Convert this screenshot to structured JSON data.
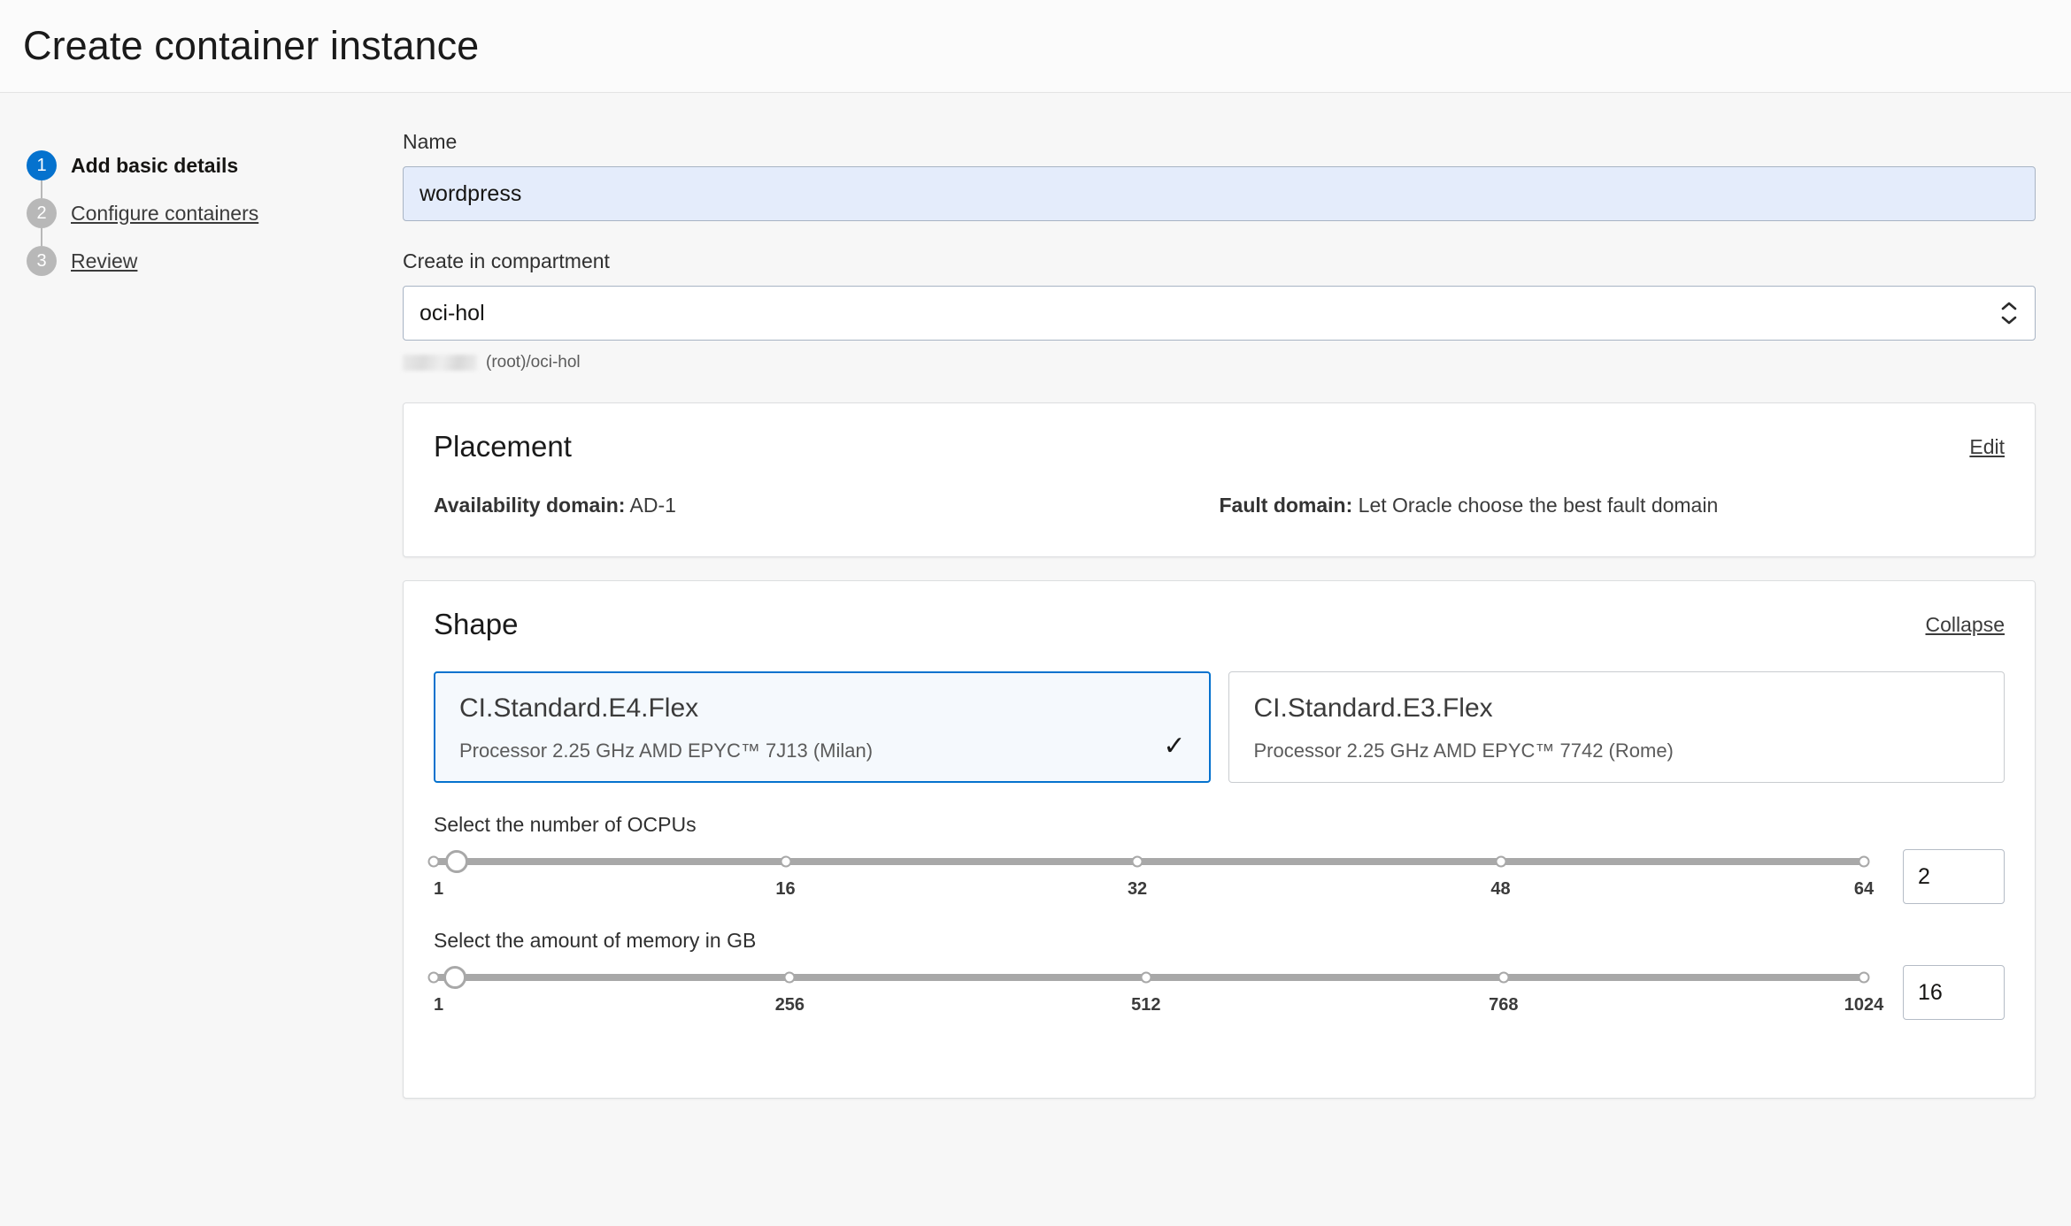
{
  "header": {
    "title": "Create container instance"
  },
  "stepper": {
    "steps": [
      {
        "num": "1",
        "label": "Add basic details",
        "state": "active"
      },
      {
        "num": "2",
        "label": "Configure containers",
        "state": "link"
      },
      {
        "num": "3",
        "label": "Review",
        "state": "link"
      }
    ]
  },
  "form": {
    "name_label": "Name",
    "name_value": "wordpress",
    "name_placeholder": "",
    "compartment_label": "Create in compartment",
    "compartment_value": "oci-hol",
    "compartment_path": "(root)/oci-hol"
  },
  "placement": {
    "title": "Placement",
    "action": "Edit",
    "availability_domain_label": "Availability domain:",
    "availability_domain_value": "AD-1",
    "fault_domain_label": "Fault domain:",
    "fault_domain_value": "Let Oracle choose the best fault domain"
  },
  "shape": {
    "title": "Shape",
    "action": "Collapse",
    "cards": [
      {
        "name": "CI.Standard.E4.Flex",
        "desc": "Processor 2.25 GHz AMD EPYC™ 7J13 (Milan)",
        "selected": true,
        "check": "✓"
      },
      {
        "name": "CI.Standard.E3.Flex",
        "desc": "Processor 2.25 GHz AMD EPYC™ 7742 (Rome)",
        "selected": false,
        "check": ""
      }
    ],
    "ocpu": {
      "label": "Select the number of OCPUs",
      "value": "2",
      "min": 1,
      "max": 64,
      "ticks": [
        "1",
        "16",
        "32",
        "48",
        "64"
      ],
      "tick_positions": [
        0,
        24.6,
        49.2,
        74.6,
        100
      ]
    },
    "memory": {
      "label": "Select the amount of memory in GB",
      "value": "16",
      "min": 1,
      "max": 1024,
      "ticks": [
        "1",
        "256",
        "512",
        "768",
        "1024"
      ],
      "tick_positions": [
        0,
        24.9,
        49.8,
        74.8,
        100
      ]
    }
  },
  "colors": {
    "accent": "#0572ce",
    "input_focus_bg": "#e4ecfb",
    "page_bg": "#f7f7f7",
    "slider_track": "#a8a8a8"
  }
}
